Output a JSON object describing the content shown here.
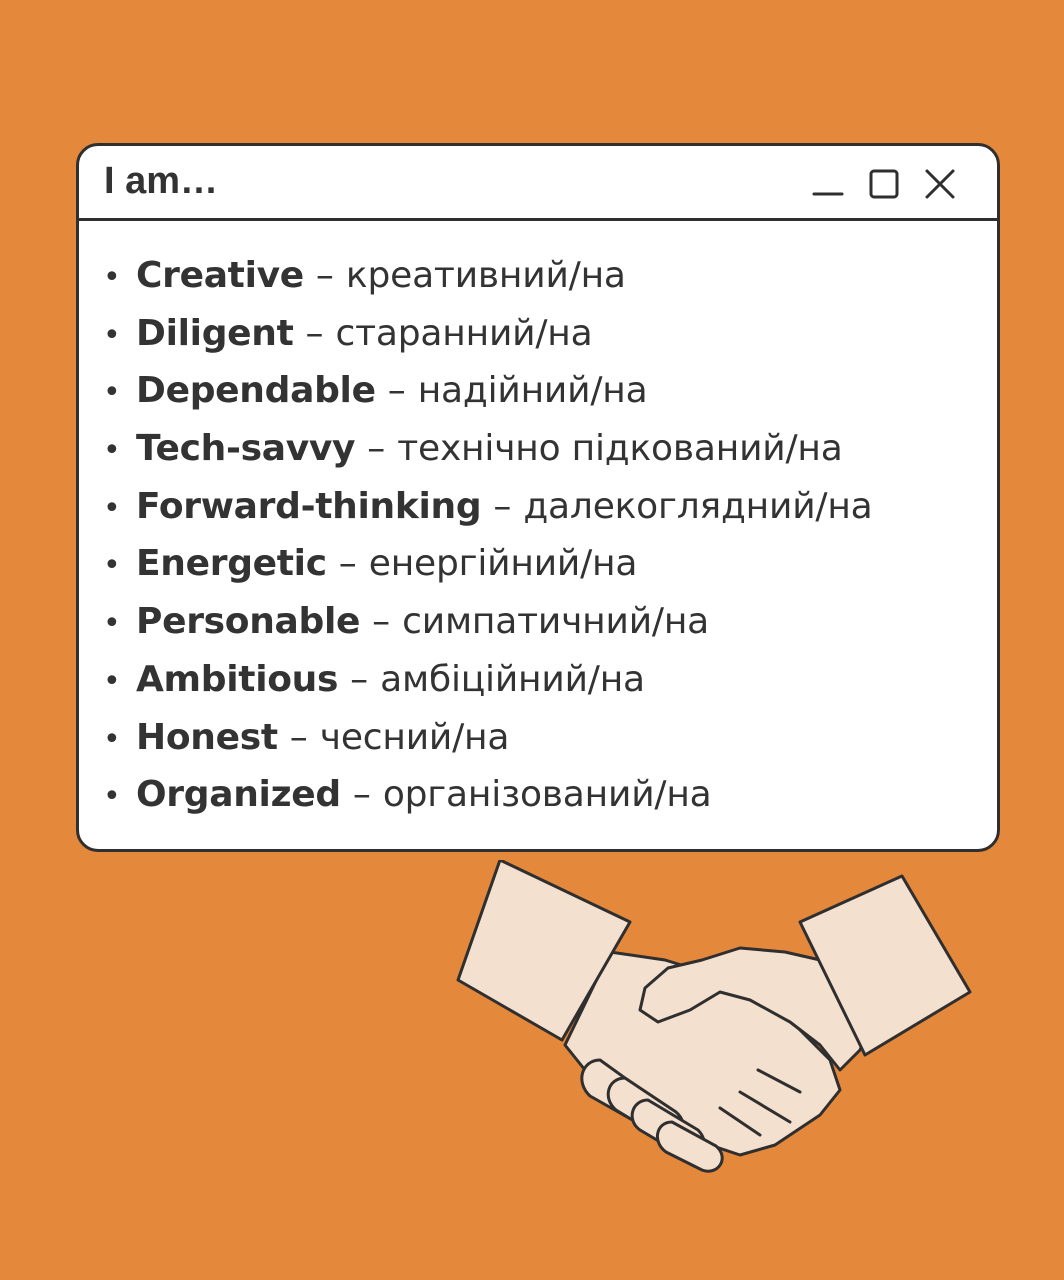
{
  "window": {
    "title": "I am…",
    "controls": [
      "minimize-icon",
      "maximize-icon",
      "close-icon"
    ]
  },
  "items": [
    {
      "term": "Creative",
      "dash": "–",
      "translation": "креативний/на"
    },
    {
      "term": "Diligent",
      "dash": "–",
      "translation": "старанний/на"
    },
    {
      "term": "Dependable",
      "dash": "–",
      "translation": "надійний/на"
    },
    {
      "term": "Tech-savvy",
      "dash": "–",
      "translation": "технічно підкований/на"
    },
    {
      "term": "Forward-thinking",
      "dash": "–",
      "translation": "далекоглядний/на"
    },
    {
      "term": "Energetic",
      "dash": "–",
      "translation": "енергійний/на"
    },
    {
      "term": "Personable",
      "dash": "–",
      "translation": "симпатичний/на"
    },
    {
      "term": "Ambitious",
      "dash": "–",
      "translation": "амбіційний/на"
    },
    {
      "term": "Honest",
      "dash": "–",
      "translation": "чесний/на"
    },
    {
      "term": "Organized",
      "dash": "–",
      "translation": "організований/на"
    }
  ],
  "illustration": {
    "icon": "handshake-icon"
  },
  "colors": {
    "background": "#e4883c",
    "window": "#ffffff",
    "outline": "#2f2f2f",
    "text": "#333333",
    "skin": "#f4e0cf"
  }
}
